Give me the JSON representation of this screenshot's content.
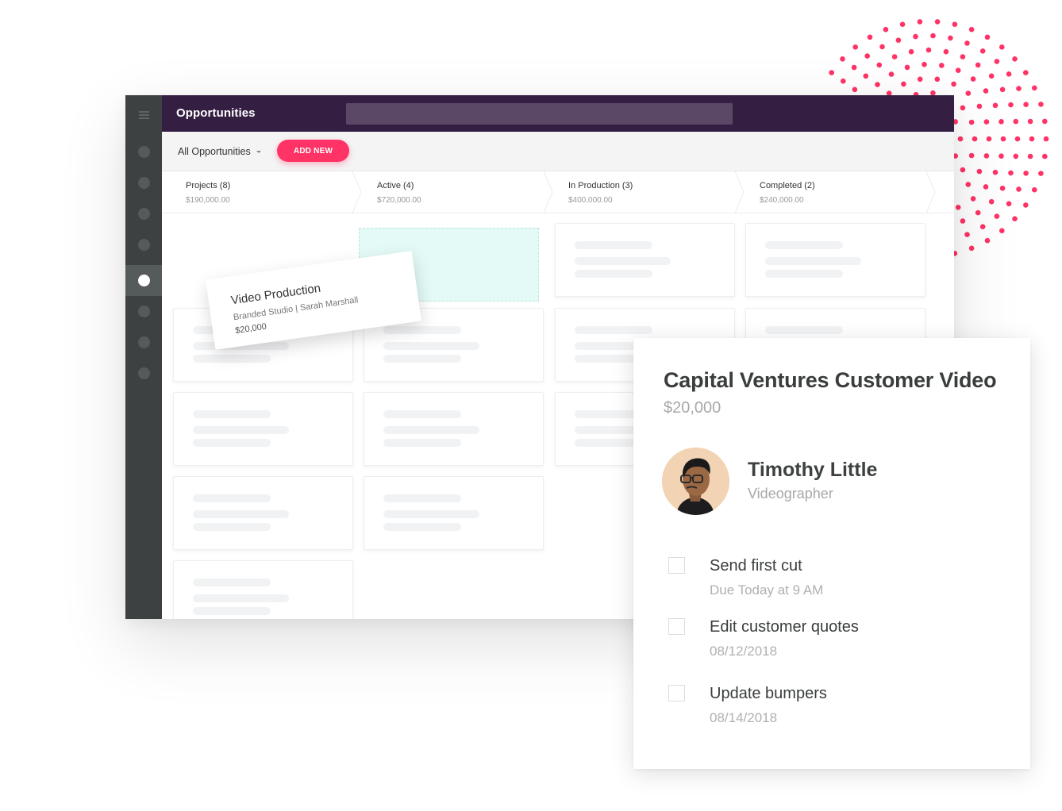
{
  "colors": {
    "accent": "#ff3366",
    "header": "#341f43",
    "rail": "#3d4141",
    "dropzone": "#e3faf6"
  },
  "app": {
    "title": "Opportunities",
    "search_placeholder": "",
    "menu_icon": "hamburger-icon",
    "rail_items": [
      {
        "icon": "nav-dot-icon",
        "active": false
      },
      {
        "icon": "nav-dot-icon",
        "active": false
      },
      {
        "icon": "nav-dot-icon",
        "active": false
      },
      {
        "icon": "nav-dot-icon",
        "active": false
      },
      {
        "icon": "nav-dot-icon",
        "active": true
      },
      {
        "icon": "nav-dot-icon",
        "active": false
      },
      {
        "icon": "nav-dot-icon",
        "active": false
      },
      {
        "icon": "nav-dot-icon",
        "active": false
      }
    ]
  },
  "toolbar": {
    "filter_label": "All Opportunities",
    "add_label": "ADD NEW"
  },
  "stages": [
    {
      "name": "Projects (8)",
      "amount": "$190,000.00"
    },
    {
      "name": "Active (4)",
      "amount": "$720,000.00"
    },
    {
      "name": "In Production (3)",
      "amount": "$400,000.00"
    },
    {
      "name": "Completed (2)",
      "amount": "$240,000.00"
    }
  ],
  "drag_card": {
    "title": "Video Production",
    "subtitle": "Branded Studio | Sarah Marshall",
    "amount": "$20,000"
  },
  "detail": {
    "title": "Capital Ventures Customer Video",
    "amount": "$20,000",
    "person": {
      "name": "Timothy Little",
      "role": "Videographer"
    },
    "tasks": [
      {
        "title": "Send first cut",
        "due": "Due Today at 9 AM",
        "checked": false
      },
      {
        "title": "Edit customer quotes",
        "due": "08/12/2018",
        "checked": false
      },
      {
        "title": "Update bumpers",
        "due": "08/14/2018",
        "checked": false
      }
    ]
  }
}
